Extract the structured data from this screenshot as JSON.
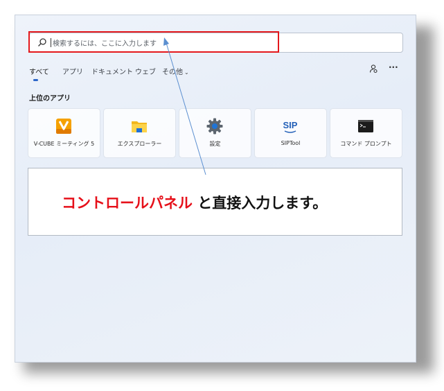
{
  "search": {
    "placeholder": "検索するには、ここに入力します"
  },
  "tabs": [
    {
      "label": "すべて"
    },
    {
      "label": "アプリ"
    },
    {
      "label": "ドキュメント"
    },
    {
      "label": "ウェブ"
    },
    {
      "label": "その他"
    }
  ],
  "toolbar": {
    "account_icon": "account-switch-icon",
    "more_label": "···"
  },
  "section": {
    "title": "上位のアプリ"
  },
  "apps": [
    {
      "label": "V-CUBE ミーティング 5",
      "icon": "vcube-icon"
    },
    {
      "label": "エクスプローラー",
      "icon": "folder-icon"
    },
    {
      "label": "設定",
      "icon": "gear-icon"
    },
    {
      "label": "SIPTool",
      "icon": "sip-icon"
    },
    {
      "label": "コマンド プロンプト",
      "icon": "terminal-icon"
    }
  ],
  "callout": {
    "highlight": "コントロールパネル",
    "rest": " と直接入力します。",
    "highlight_color": "#e6101a"
  },
  "colors": {
    "annotation_box": "#e4181c",
    "accent": "#2b66c9",
    "arrow": "#5b8fd0"
  }
}
